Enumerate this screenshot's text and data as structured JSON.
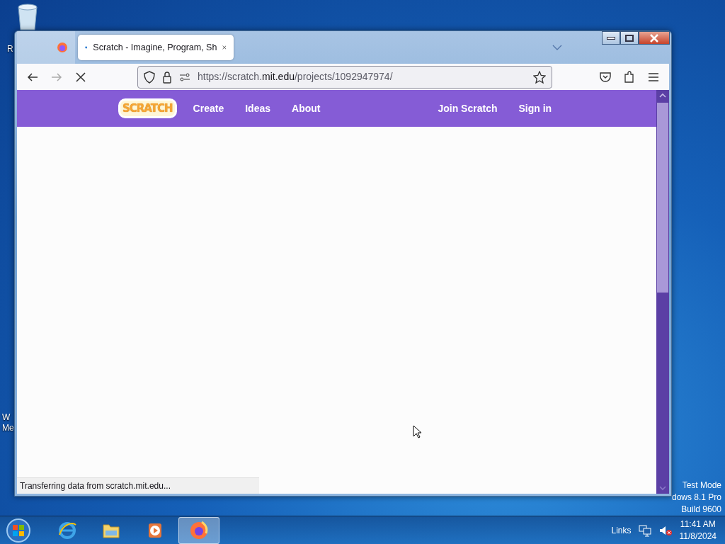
{
  "desktop": {
    "icons": [
      {
        "kind": "recycle",
        "label": "R"
      },
      {
        "kind": "plain",
        "label": "W"
      },
      {
        "kind": "plain",
        "label": "Me"
      }
    ]
  },
  "browser": {
    "tabs": [
      {
        "kind": "pinned",
        "selected": false
      },
      {
        "kind": "page",
        "title": "Scratch - Imagine, Program, Sh",
        "selected": true
      }
    ],
    "loading": true,
    "url": {
      "prefix": "https://scratch.",
      "domain": "mit.edu",
      "path": "/projects/1092947974/"
    },
    "page": {
      "logo": "SCRATCH",
      "nav_left": [
        "Create",
        "Ideas",
        "About"
      ],
      "nav_right": [
        "Join Scratch",
        "Sign in"
      ]
    },
    "status": "Transferring data from scratch.mit.edu..."
  },
  "os_info": [
    "Test Mode",
    "dows 8.1 Pro",
    "Build 9600"
  ],
  "taskbar": {
    "apps": [
      {
        "kind": "ie",
        "selected": false
      },
      {
        "kind": "explorer",
        "selected": false
      },
      {
        "kind": "media",
        "selected": false
      },
      {
        "kind": "firefox",
        "selected": true
      }
    ],
    "links": "Links",
    "time": "11:41 AM",
    "date": "11/8/2024"
  }
}
